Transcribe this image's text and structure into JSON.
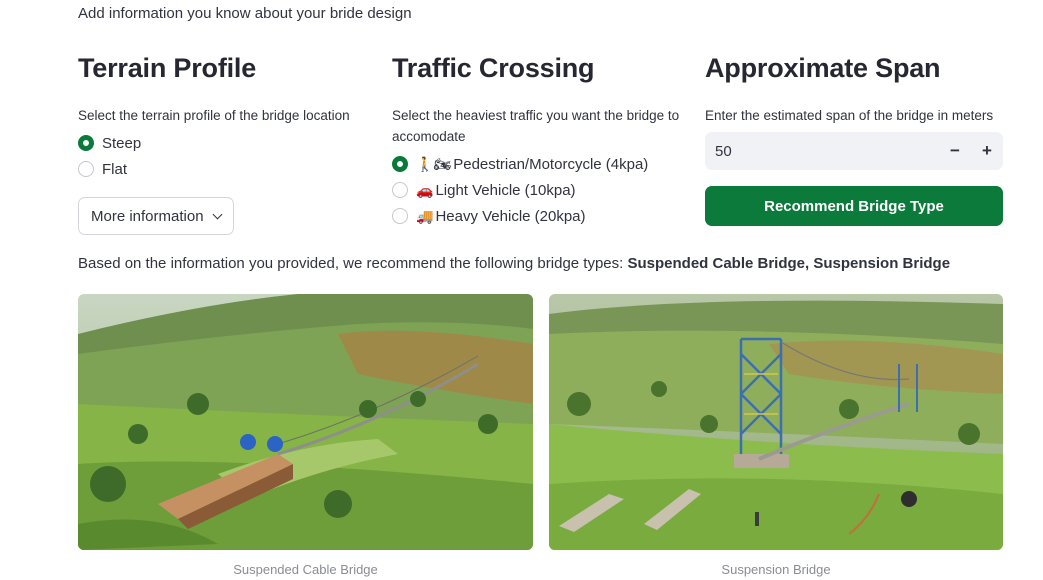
{
  "intro": "Add information you know about your bride design",
  "terrain": {
    "title": "Terrain Profile",
    "label": "Select the terrain profile of the bridge location",
    "options": [
      {
        "label": "Steep",
        "selected": true
      },
      {
        "label": "Flat",
        "selected": false
      }
    ],
    "more_button": "More information"
  },
  "traffic": {
    "title": "Traffic Crossing",
    "label": "Select the heaviest traffic you want the bridge to accomodate",
    "options": [
      {
        "emoji": "🚶🏍",
        "label": "Pedestrian/Motorcycle (4kpa)",
        "selected": true
      },
      {
        "emoji": "🚗",
        "label": "Light Vehicle (10kpa)",
        "selected": false
      },
      {
        "emoji": "🚚",
        "label": "Heavy Vehicle (20kpa)",
        "selected": false
      }
    ]
  },
  "span": {
    "title": "Approximate Span",
    "label": "Enter the estimated span of the bridge in meters",
    "value": "50",
    "minus": "−",
    "plus": "+",
    "button": "Recommend Bridge Type"
  },
  "result": {
    "prefix": "Based on the information you provided, we recommend the following bridge types: ",
    "types": "Suspended Cable Bridge, Suspension Bridge"
  },
  "images": [
    {
      "caption": "Suspended Cable Bridge"
    },
    {
      "caption": "Suspension Bridge"
    }
  ],
  "colors": {
    "accent": "#0b7a3a",
    "input_bg": "#f0f2f6",
    "text": "#31333f"
  }
}
